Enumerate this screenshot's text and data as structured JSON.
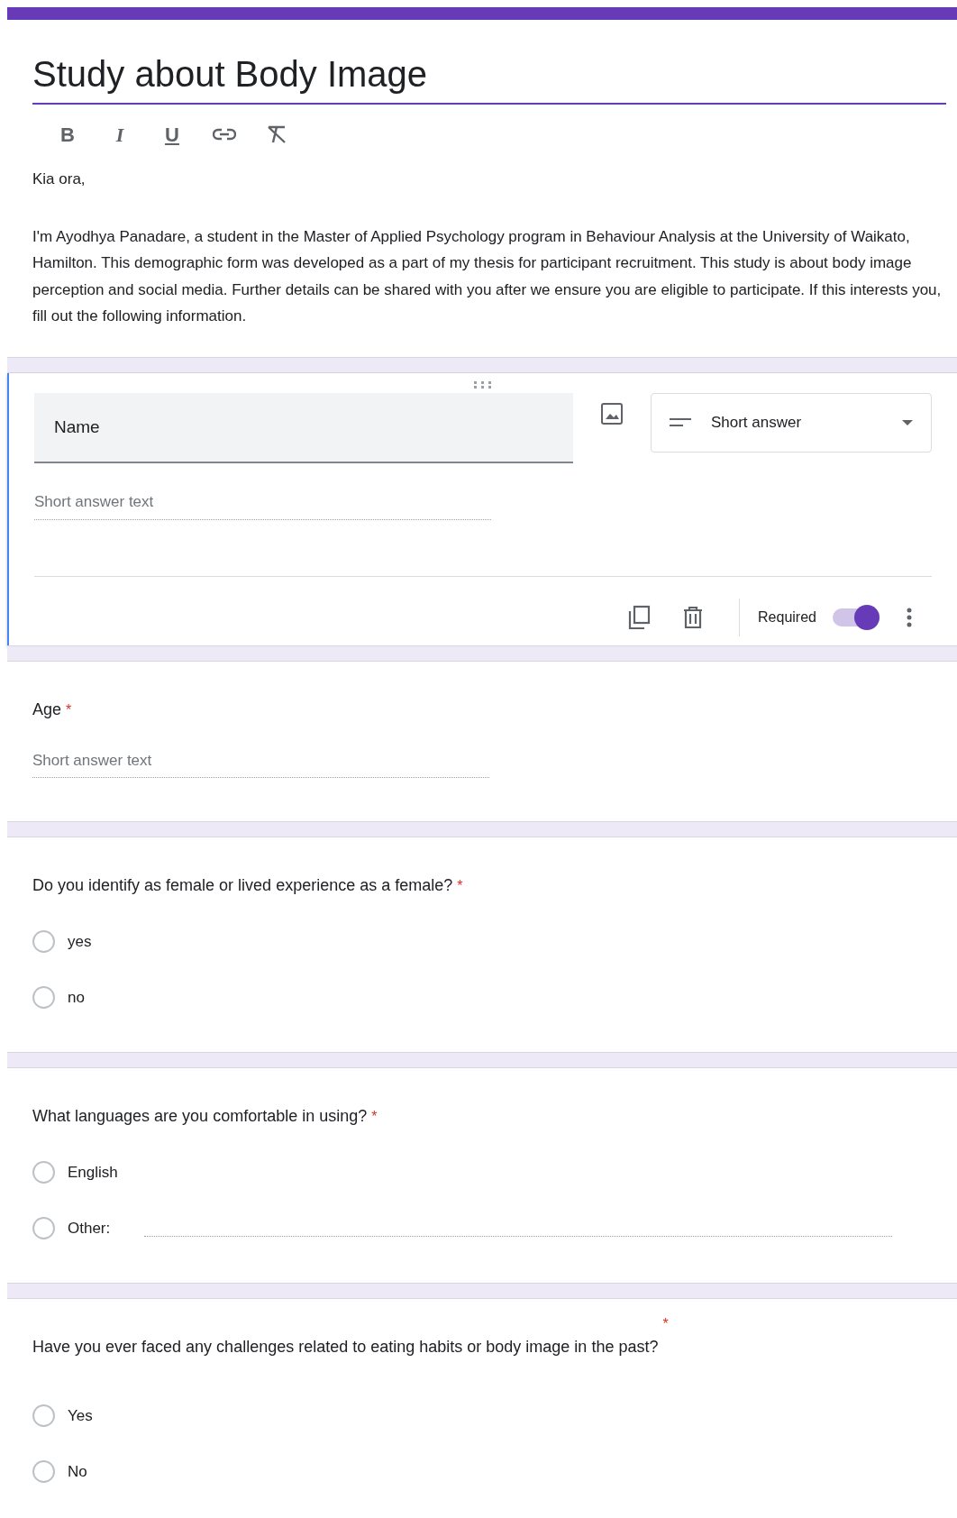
{
  "form": {
    "title": "Study about Body Image",
    "toolbar": [
      {
        "kind": "bold",
        "glyph": "B"
      },
      {
        "kind": "italic",
        "glyph": "I"
      },
      {
        "kind": "underline",
        "glyph": "U"
      },
      {
        "kind": "link"
      },
      {
        "kind": "clear"
      }
    ],
    "greeting": "Kia ora,",
    "description": "I'm Ayodhya Panadare, a student in the Master of Applied Psychology program in Behaviour Analysis at the University of Waikato, Hamilton. This demographic form was developed as a part of my thesis for participant recruitment. This study is about body image perception and social media. Further details can be shared with you after we ensure you are eligible to participate. If this interests you, fill out the following information."
  },
  "questions": [
    {
      "kind": "short",
      "editing": true,
      "title": "Name",
      "type_label": "Short answer",
      "placeholder": "Short answer text",
      "required_label": "Required",
      "required": true
    },
    {
      "kind": "short",
      "editing": false,
      "title": "Age",
      "placeholder": "Short answer text",
      "required": true,
      "asterisk": "*"
    },
    {
      "kind": "choice",
      "editing": false,
      "title": "Do you identify as female or lived experience as a female?",
      "required": true,
      "asterisk": "*",
      "options": [
        {
          "kind": "plain",
          "label": "yes",
          "selected": false
        },
        {
          "kind": "plain",
          "label": "no",
          "selected": false
        }
      ]
    },
    {
      "kind": "choice",
      "editing": false,
      "title": "What languages are you comfortable in using?",
      "required": true,
      "asterisk": "*",
      "options": [
        {
          "kind": "plain",
          "label": "English",
          "selected": false
        },
        {
          "kind": "other",
          "label": "Other:",
          "selected": false
        }
      ]
    },
    {
      "kind": "choice",
      "editing": false,
      "title": "Have you ever faced any challenges related to eating habits or body image in the past?",
      "required": true,
      "asterisk": "*",
      "options": [
        {
          "kind": "plain",
          "label": "Yes",
          "selected": false
        },
        {
          "kind": "plain",
          "label": "No",
          "selected": false
        }
      ]
    }
  ]
}
